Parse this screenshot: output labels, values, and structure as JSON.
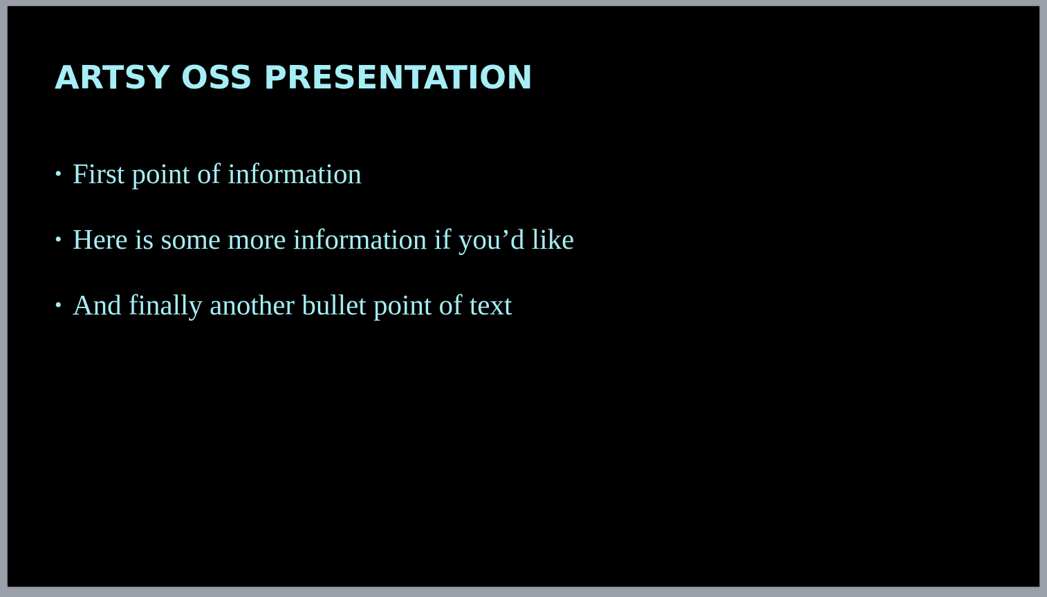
{
  "slide": {
    "title": "ARTSY OSS PRESENTATION",
    "bullet_marker": "•",
    "bullets": [
      "First point of information",
      "Here is some more information if you’d like",
      "And finally another bullet point of text"
    ]
  },
  "colors": {
    "background": "#000000",
    "text": "#a5eef6",
    "frame": "#9aa0aa"
  }
}
